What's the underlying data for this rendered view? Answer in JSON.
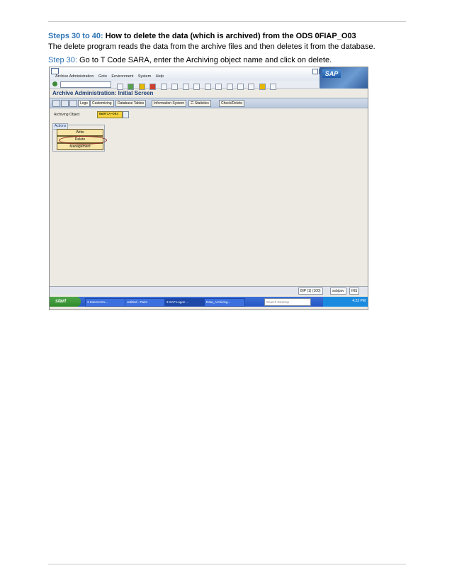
{
  "document": {
    "heading_lead": "Steps 30 to 40:",
    "heading_text": "How to delete the data (which is archived) from the ODS 0FIAP_O03",
    "subheading": "The delete program reads the data from the archive files and then deletes it from the database.",
    "step_lead": "Step 30:",
    "step_text": "Go to T Code SARA, enter the Archiving object name and click on delete."
  },
  "sap": {
    "menu": [
      "Archive Administration",
      "Goto",
      "Environment",
      "System",
      "Help"
    ],
    "logo_text": "SAP",
    "screen_title": "Archive Administration: Initial Screen",
    "app_toolbar": [
      "Logs",
      "Customizing",
      "Database Tables",
      "Information System",
      "Statistics",
      "Check/Delete"
    ],
    "archiving_object_label": "Archiving Object",
    "archiving_object_value": "BWOFIA~O03",
    "actions_title": "Actions",
    "actions": [
      "Write",
      "Delete",
      "Management"
    ],
    "status": {
      "system": "BIP (1) (100)",
      "server": "ssbipsv",
      "mode": "INS"
    }
  },
  "taskbar": {
    "start": "start",
    "tasks": [
      "3 Internet Ex...",
      "untitled - Paint",
      "3 SAP Logon ...",
      "Data_Archiving..."
    ],
    "search_placeholder": "Search Desktop",
    "clock": "4:22 PM"
  }
}
